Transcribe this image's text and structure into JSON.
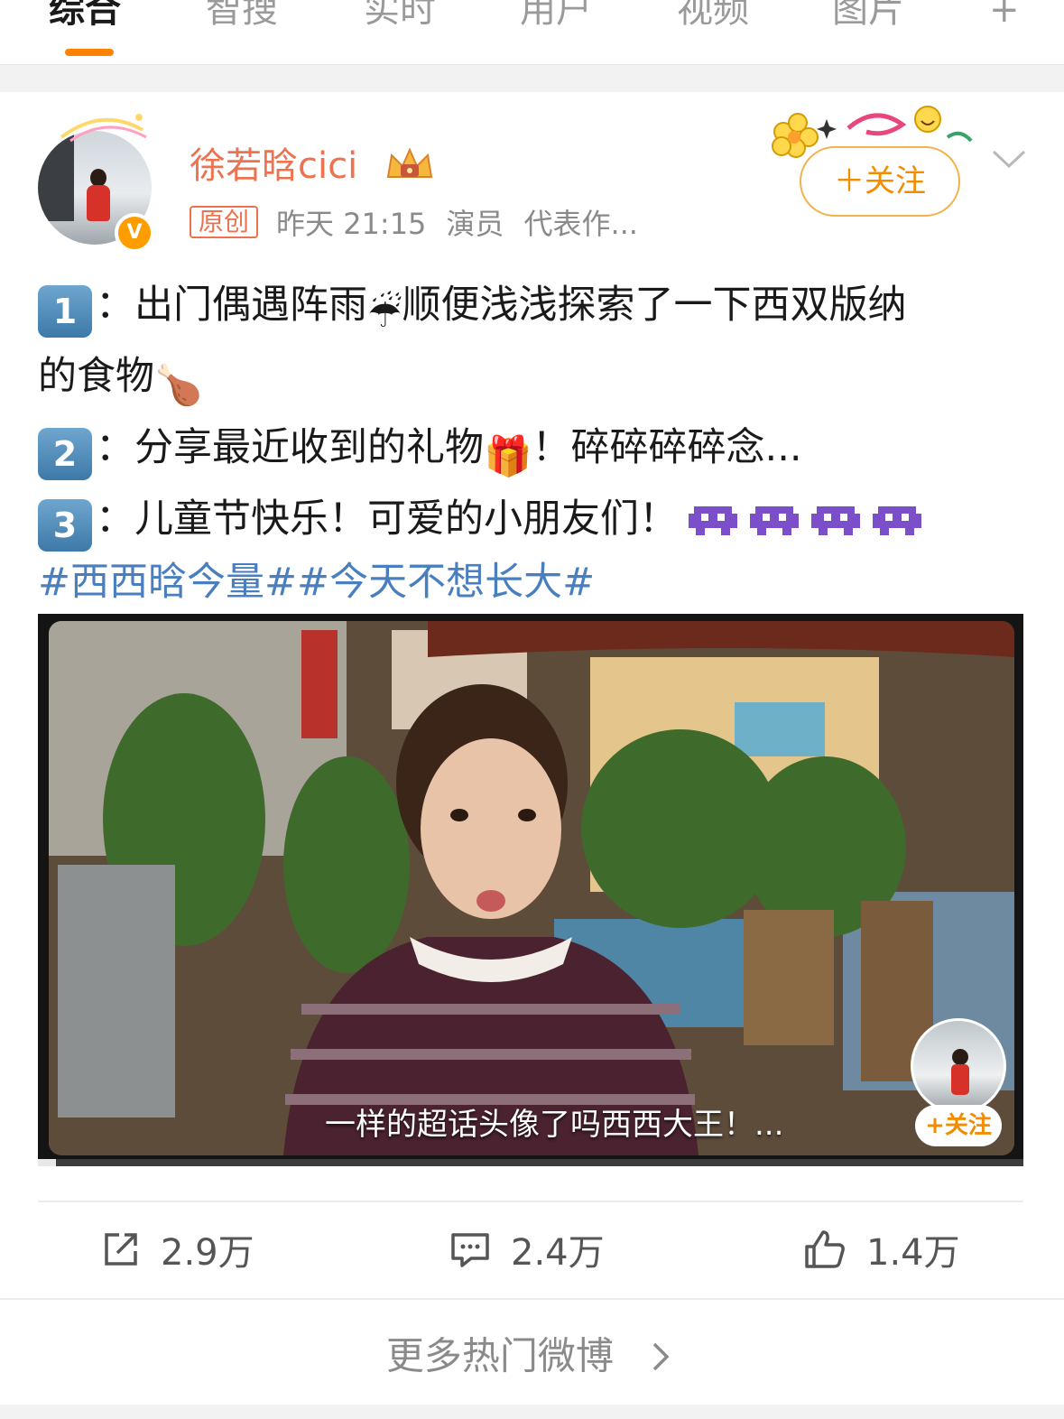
{
  "tabs": [
    {
      "label": "综合",
      "active": true
    },
    {
      "label": "智搜"
    },
    {
      "label": "实时"
    },
    {
      "label": "用户"
    },
    {
      "label": "视频"
    },
    {
      "label": "图片"
    },
    {
      "label": "+"
    }
  ],
  "colors": {
    "accent": "#ff8200",
    "username": "#eb7350",
    "hashtag": "#4a7fbf",
    "follow": "#f28c00"
  },
  "post": {
    "username": "徐若晗cici",
    "badge": "V",
    "original_tag": "原创",
    "time": "昨天 21:15",
    "role": "演员",
    "works": "代表作...",
    "follow_label": "＋关注",
    "lines": [
      {
        "num": "1",
        "text_a": "：出门偶遇阵雨",
        "emoji_a": "☔",
        "text_b": "顺便浅浅探索了一下西双版纳"
      },
      {
        "text_a": "的食物",
        "emoji_a": "🍗"
      },
      {
        "num": "2",
        "text_a": "：分享最近收到的礼物",
        "emoji_a": "🎁",
        "text_b": "！碎碎碎碎念..."
      },
      {
        "num": "3",
        "text_a": "：儿童节快乐！可爱的小朋友们！"
      }
    ],
    "hashtags": "#西西晗今量##今天不想长大#",
    "icons": {
      "crown": "crown-icon",
      "alien": "alien-monster-icon",
      "chevron": "chevron-down-icon"
    }
  },
  "video": {
    "subtitle": "一样的超话头像了吗西西大王！...",
    "mini_follow": "+关注"
  },
  "actions": {
    "repost": "2.9万",
    "comment": "2.4万",
    "like": "1.4万"
  },
  "more_label": "更多热门微博"
}
